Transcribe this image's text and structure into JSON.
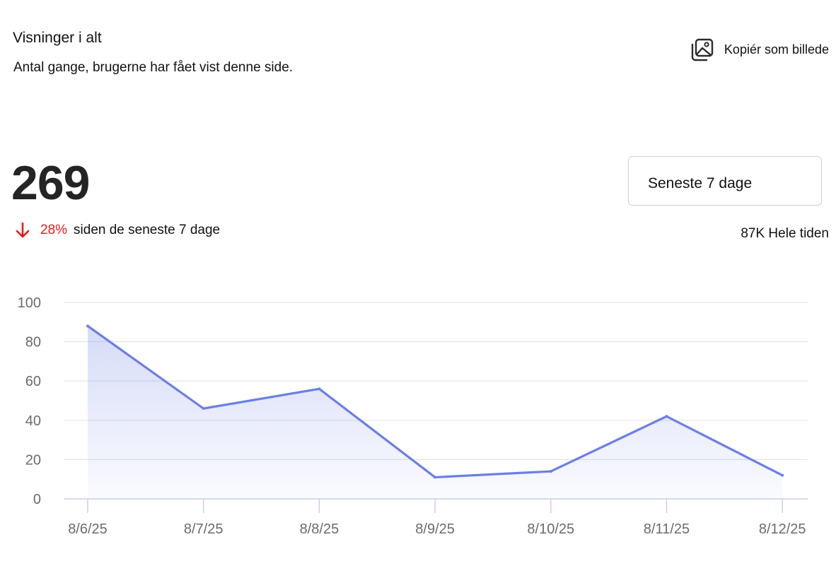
{
  "card": {
    "title": "Visninger i alt",
    "subtitle": "Antal gange, brugerne har fået vist denne side."
  },
  "actions": {
    "copy_label": "Kopiér som billede",
    "copy_icon": "image-copy-icon"
  },
  "summary": {
    "total": "269",
    "change_pct": "28%",
    "change_direction": "down",
    "change_text": "siden de seneste 7 dage",
    "all_time": "87K Hele tiden"
  },
  "range_select": {
    "selected": "Seneste 7 dage"
  },
  "colors": {
    "line": "#6b7fe6",
    "negative": "#e8181c"
  },
  "chart_data": {
    "type": "area",
    "categories": [
      "8/6/25",
      "8/7/25",
      "8/8/25",
      "8/9/25",
      "8/10/25",
      "8/11/25",
      "8/12/25"
    ],
    "series": [
      {
        "values": [
          88,
          46,
          56,
          11,
          14,
          42,
          12
        ]
      }
    ],
    "yticks": [
      0,
      20,
      40,
      60,
      80,
      100
    ],
    "ylim": [
      0,
      100
    ],
    "grid": true,
    "legend": "none"
  }
}
